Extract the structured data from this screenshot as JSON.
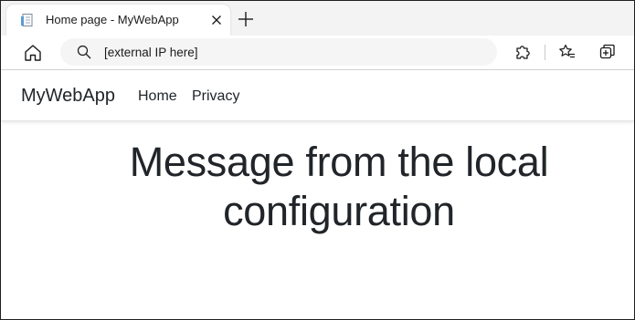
{
  "browser": {
    "tab": {
      "title": "Home page - MyWebApp",
      "favicon": "page-icon",
      "close_icon": "close-icon"
    },
    "new_tab_icon": "plus-icon",
    "toolbar": {
      "home_icon": "home-icon",
      "address": {
        "search_icon": "search-icon",
        "value": "[external IP here]"
      },
      "extensions_icon": "puzzle-icon",
      "favorites_icon": "star-list-icon",
      "collections_icon": "collections-icon"
    }
  },
  "page": {
    "brand": "MyWebApp",
    "nav": [
      {
        "label": "Home"
      },
      {
        "label": "Privacy"
      }
    ],
    "hero": {
      "line1": "Message from the local",
      "line2": "configuration"
    }
  },
  "colors": {
    "tabstrip_bg": "#f3f3f3",
    "address_bg": "#f5f5f5",
    "text": "#212529"
  }
}
